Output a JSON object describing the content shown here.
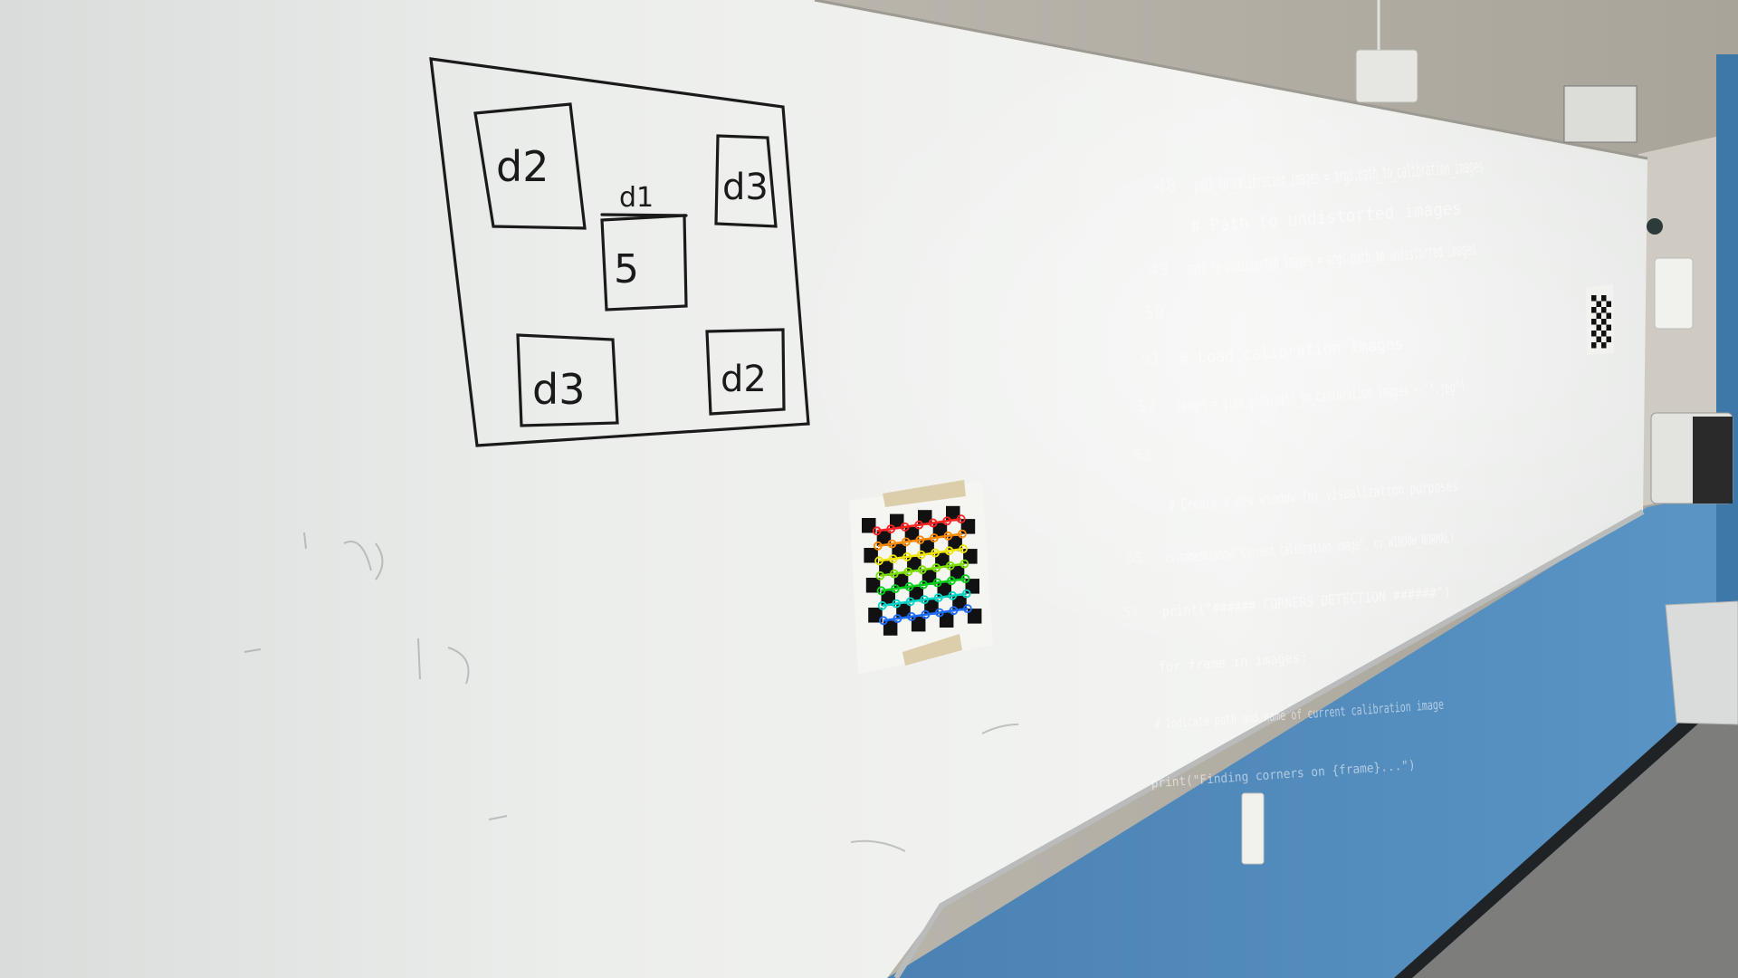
{
  "scene": {
    "diagram": {
      "cells": [
        {
          "label": "d2"
        },
        {
          "label": "d3"
        },
        {
          "label": "5"
        },
        {
          "label": "d3"
        },
        {
          "label": "d2"
        }
      ],
      "top_label": "d1"
    },
    "projected_code": {
      "lines": [
        {
          "num": "48",
          "text": "path_to_calibration_images = args.path_to_calibration_images"
        },
        {
          "num": "",
          "text": "# Path to undistorted images"
        },
        {
          "num": "49",
          "text": "path_to_undistorted_images = args.path_to_undistorted_images"
        },
        {
          "num": "50",
          "text": ""
        },
        {
          "num": "51",
          "text": "# Load calibration images"
        },
        {
          "num": "52",
          "text": "images = glob.glob(path_to_calibration_images + \"*.jpg\")"
        },
        {
          "num": "53",
          "text": ""
        },
        {
          "num": "",
          "text": "# Create a new window for visualization purposes"
        },
        {
          "num": "55",
          "text": "cv.namedWindow(\"Current calibration image\", cv.WINDOW_NORMAL)"
        },
        {
          "num": "57",
          "text": "print(\"###### CORNERS DETECTION ######\")"
        },
        {
          "num": "",
          "text": "for frame in images:"
        },
        {
          "num": "",
          "text": "# Indicate path and name of current calibration image"
        },
        {
          "num": "",
          "text": "print(\"Finding corners on {frame}...\")"
        }
      ]
    },
    "colors": {
      "wall_top": "#bdb8ad",
      "board": "#e9ecea",
      "wall_blue": "#4e86b6",
      "floor": "#7d7d7b",
      "marker": "#1a1a1a"
    }
  }
}
